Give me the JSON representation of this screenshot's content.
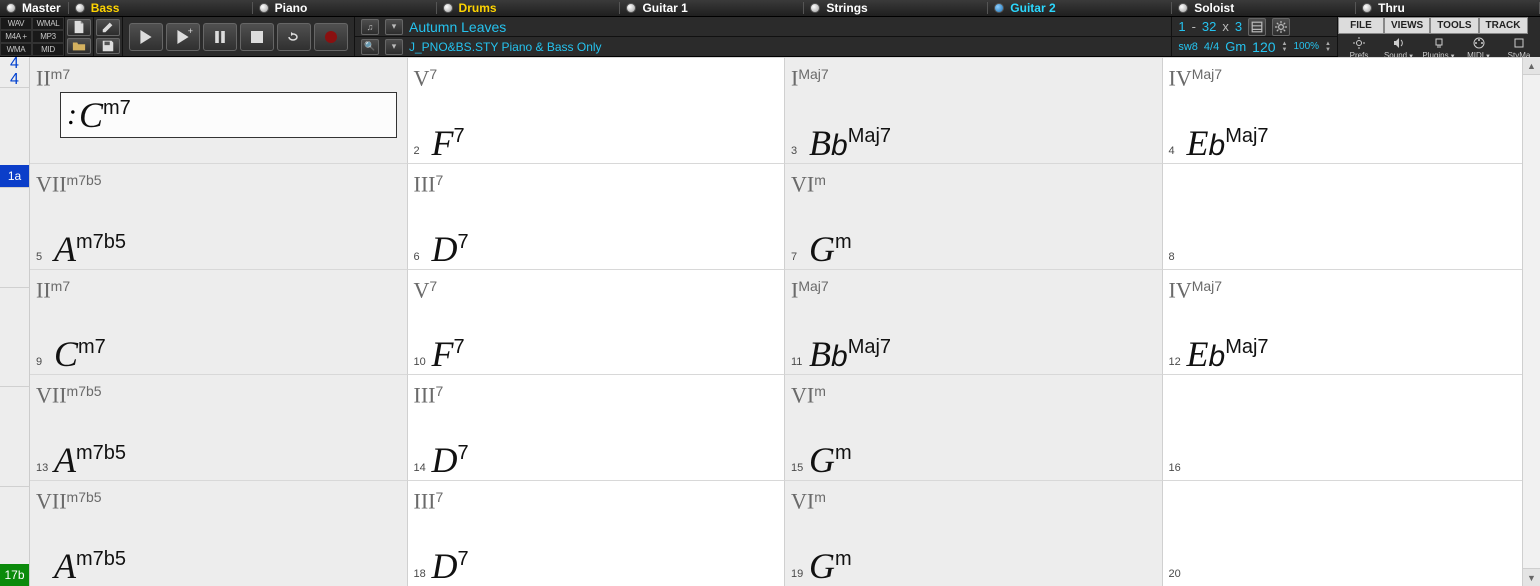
{
  "tracks": [
    {
      "label": "Master",
      "on": false,
      "cls": ""
    },
    {
      "label": "Bass",
      "on": false,
      "cls": "yellow"
    },
    {
      "label": "Piano",
      "on": false,
      "cls": ""
    },
    {
      "label": "Drums",
      "on": false,
      "cls": "yellow"
    },
    {
      "label": "Guitar 1",
      "on": false,
      "cls": ""
    },
    {
      "label": "Strings",
      "on": false,
      "cls": ""
    },
    {
      "label": "Guitar 2",
      "on": true,
      "cls": "cyan"
    },
    {
      "label": "Soloist",
      "on": false,
      "cls": ""
    },
    {
      "label": "Thru",
      "on": false,
      "cls": ""
    }
  ],
  "fmt": [
    "WAV",
    "WMAL",
    "M4A +",
    "MP3",
    "WMA",
    "MID"
  ],
  "song_title": "Autumn Leaves",
  "style_text": "J_PNO&BS.STY Piano & Bass Only",
  "range": {
    "from": "1",
    "to": "32",
    "reps": "3"
  },
  "style_short": "sw8",
  "time_sig_info": "4/4",
  "key": "Gm",
  "tempo": "120",
  "tempo_pct": "100%",
  "menus_top": [
    "FILE",
    "VIEWS",
    "TOOLS",
    "TRACK"
  ],
  "menu_btns": [
    {
      "label": "Prefs",
      "icon": "gear"
    },
    {
      "label": "Sound",
      "icon": "speaker",
      "drop": true
    },
    {
      "label": "Plugins",
      "icon": "plug",
      "drop": true
    },
    {
      "label": "MIDI",
      "icon": "midi",
      "drop": true
    },
    {
      "label": "StyMa",
      "icon": "sty"
    }
  ],
  "time_sig": {
    "num": "4",
    "den": "4"
  },
  "rows": [
    {
      "part": "1a",
      "partColor": "blue",
      "bars": [
        {
          "n": "",
          "rn": "II",
          "rnx": "m7",
          "ch": "C",
          "chx": "m7",
          "sel": true,
          "shade": true
        },
        {
          "n": "2",
          "rn": "V",
          "rnx": "7",
          "ch": "F",
          "chx": "7",
          "shade": false
        },
        {
          "n": "3",
          "rn": "I",
          "rnx": "Maj7",
          "ch": "Bb",
          "chx": "Maj7",
          "shade": true
        },
        {
          "n": "4",
          "rn": "IV",
          "rnx": "Maj7",
          "ch": "Eb",
          "chx": "Maj7",
          "shade": false
        }
      ]
    },
    {
      "part": "",
      "bars": [
        {
          "n": "5",
          "rn": "VII",
          "rnx": "m7b5",
          "ch": "A",
          "chx": "m7b5",
          "shade": true
        },
        {
          "n": "6",
          "rn": "III",
          "rnx": "7",
          "ch": "D",
          "chx": "7",
          "shade": false
        },
        {
          "n": "7",
          "rn": "VI",
          "rnx": "m",
          "ch": "G",
          "chx": "m",
          "shade": true
        },
        {
          "n": "8",
          "rn": "",
          "rnx": "",
          "ch": "",
          "chx": "",
          "shade": false
        }
      ]
    },
    {
      "part": "",
      "bars": [
        {
          "n": "9",
          "rn": "II",
          "rnx": "m7",
          "ch": "C",
          "chx": "m7",
          "shade": true
        },
        {
          "n": "10",
          "rn": "V",
          "rnx": "7",
          "ch": "F",
          "chx": "7",
          "shade": false
        },
        {
          "n": "11",
          "rn": "I",
          "rnx": "Maj7",
          "ch": "Bb",
          "chx": "Maj7",
          "shade": true
        },
        {
          "n": "12",
          "rn": "IV",
          "rnx": "Maj7",
          "ch": "Eb",
          "chx": "Maj7",
          "shade": false
        }
      ]
    },
    {
      "part": "",
      "bars": [
        {
          "n": "13",
          "rn": "VII",
          "rnx": "m7b5",
          "ch": "A",
          "chx": "m7b5",
          "shade": true
        },
        {
          "n": "14",
          "rn": "III",
          "rnx": "7",
          "ch": "D",
          "chx": "7",
          "shade": false
        },
        {
          "n": "15",
          "rn": "VI",
          "rnx": "m",
          "ch": "G",
          "chx": "m",
          "shade": true
        },
        {
          "n": "16",
          "rn": "",
          "rnx": "",
          "ch": "",
          "chx": "",
          "shade": false
        }
      ]
    },
    {
      "part": "17b",
      "partColor": "green",
      "bars": [
        {
          "n": "",
          "rn": "VII",
          "rnx": "m7b5",
          "ch": "A",
          "chx": "m7b5",
          "shade": true
        },
        {
          "n": "18",
          "rn": "III",
          "rnx": "7",
          "ch": "D",
          "chx": "7",
          "shade": false
        },
        {
          "n": "19",
          "rn": "VI",
          "rnx": "m",
          "ch": "G",
          "chx": "m",
          "shade": true
        },
        {
          "n": "20",
          "rn": "",
          "rnx": "",
          "ch": "",
          "chx": "",
          "shade": false
        }
      ]
    }
  ]
}
